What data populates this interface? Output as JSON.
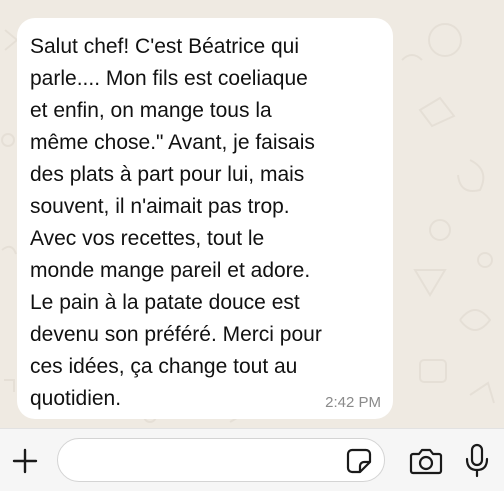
{
  "message": {
    "text": "Salut chef! C'est Béatrice qui\nparle.... Mon fils est coeliaque\net enfin, on mange tous la\nmême chose.\" Avant, je faisais\ndes plats à part pour lui, mais\nsouvent, il n'aimait pas trop.\nAvec vos recettes, tout le\nmonde mange pareil et adore.\nLe pain à la patate douce est\ndevenu son préféré. Merci pour\nces idées, ça change tout au\nquotidien.",
    "time": "2:42 PM"
  },
  "input_bar": {
    "message_value": "",
    "message_placeholder": ""
  },
  "icons": {
    "add": "plus-icon",
    "sticker": "sticker-icon",
    "camera": "camera-icon",
    "microphone": "microphone-icon"
  },
  "colors": {
    "chat_background": "#efeae2",
    "bubble_background": "#ffffff",
    "timestamp": "#8a8a8a",
    "input_bar_background": "#f6f6f6"
  }
}
